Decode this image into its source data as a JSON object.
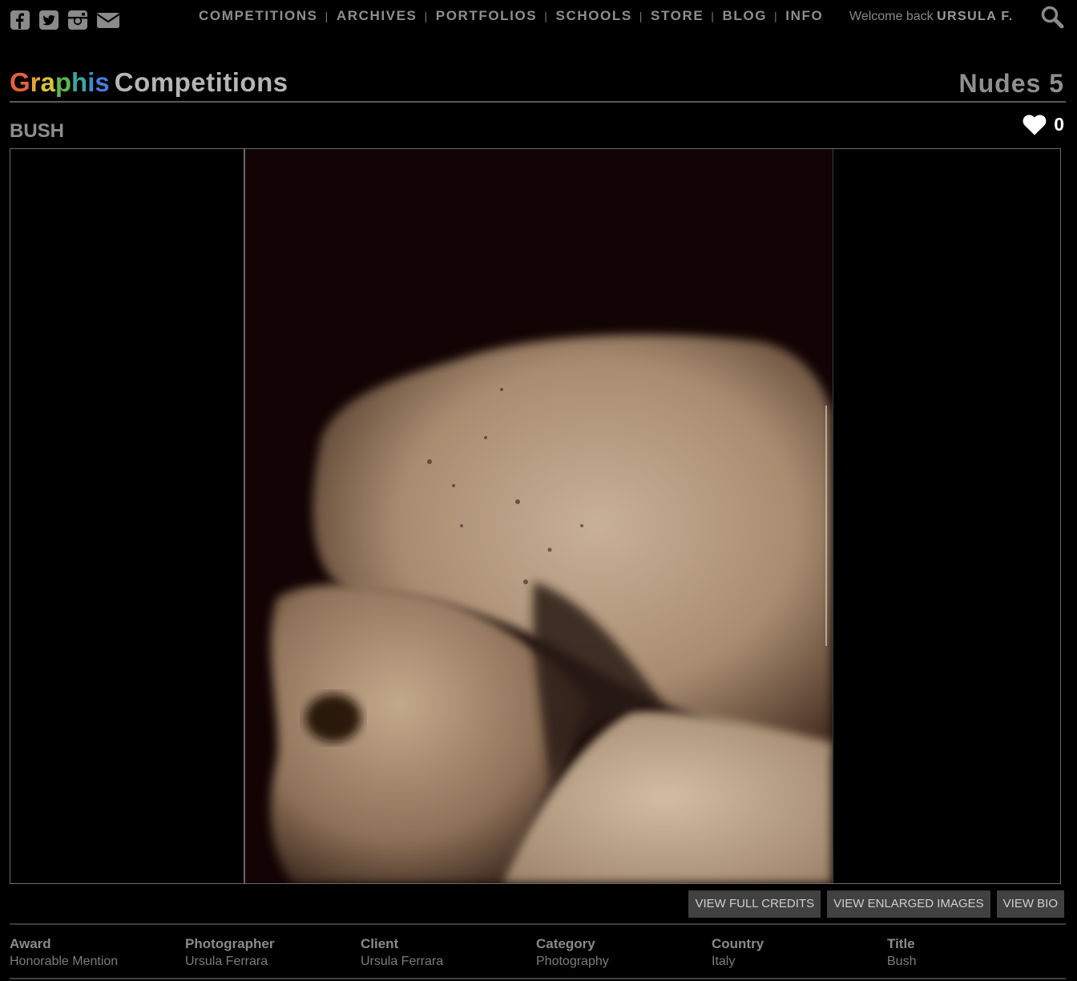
{
  "social": [
    {
      "icon": "facebook-icon"
    },
    {
      "icon": "twitter-icon"
    },
    {
      "icon": "instagram-icon"
    },
    {
      "icon": "email-icon"
    }
  ],
  "nav": {
    "items": [
      "COMPETITIONS",
      "ARCHIVES",
      "PORTFOLIOS",
      "SCHOOLS",
      "STORE",
      "BLOG",
      "INFO"
    ],
    "separator": "|"
  },
  "user": {
    "welcome": "Welcome back",
    "name": "URSULA F."
  },
  "header": {
    "logo_letters": [
      "G",
      "r",
      "a",
      "p",
      "h",
      "i",
      "s"
    ],
    "logo_colors": [
      "#e8603a",
      "#e8a23a",
      "#d8c43a",
      "#5cb848",
      "#3aa6a0",
      "#3a8ed8",
      "#4a7ae0"
    ],
    "title": "Competitions",
    "competition": "Nudes 5"
  },
  "entry": {
    "title": "BUSH",
    "likes": "0"
  },
  "buttons": {
    "credits": "VIEW FULL CREDITS",
    "enlarged": "VIEW ENLARGED IMAGES",
    "bio": "VIEW BIO"
  },
  "credits": [
    {
      "label": "Award",
      "value": "Honorable Mention"
    },
    {
      "label": "Photographer",
      "value": "Ursula Ferrara"
    },
    {
      "label": "Client",
      "value": "Ursula Ferrara"
    },
    {
      "label": "Category",
      "value": "Photography"
    },
    {
      "label": "Country",
      "value": "Italy"
    },
    {
      "label": "Title",
      "value": "Bush"
    }
  ],
  "colors": {
    "background": "#000000",
    "nav_text": "#8e8e8e",
    "button_bg": "#414141",
    "photo_tone": "#b9a184"
  }
}
